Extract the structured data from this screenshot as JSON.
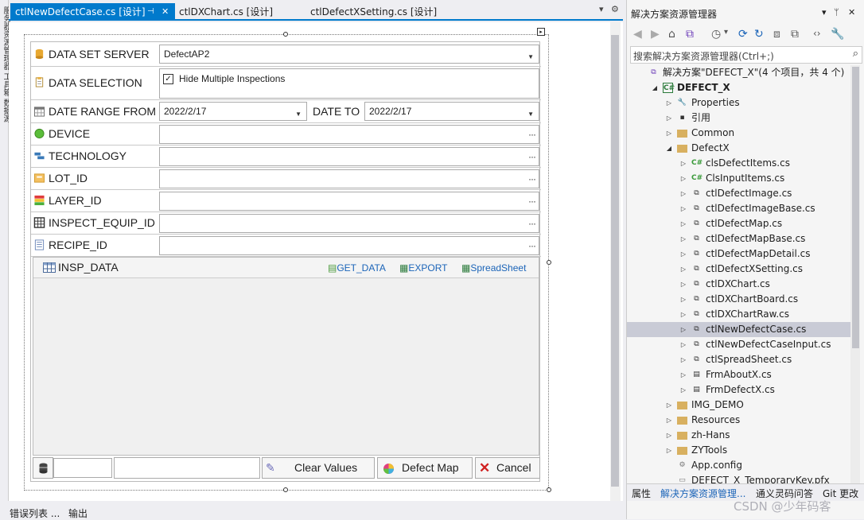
{
  "left_strip": {
    "text": "服务器资源管理器 工具箱 数据源"
  },
  "tabs": [
    {
      "label": "ctlNewDefectCase.cs [设计]",
      "active": true
    },
    {
      "label": "ctlDXChart.cs [设计]",
      "active": false
    },
    {
      "label": "ctlDefectXSetting.cs [设计]",
      "active": false
    }
  ],
  "tab_icons": {
    "pin": "⊣",
    "close": "✕",
    "dropdown": "▾",
    "settings": "⚙"
  },
  "form": {
    "server": {
      "label": "DATA SET SERVER",
      "value": "DefectAP2"
    },
    "selection": {
      "label": "DATA SELECTION",
      "checkbox_label": "Hide Multiple Inspections",
      "checked": true,
      "check_mark": "✓"
    },
    "date_from": {
      "label": "DATE RANGE FROM",
      "value": "2022/2/17"
    },
    "date_to": {
      "label": "DATE TO",
      "value": "2022/2/17"
    },
    "device": {
      "label": "DEVICE",
      "value": ""
    },
    "technology": {
      "label": "TECHNOLOGY",
      "value": ""
    },
    "lot": {
      "label": "LOT_ID",
      "value": ""
    },
    "layer": {
      "label": "LAYER_ID",
      "value": ""
    },
    "equip": {
      "label": "INSPECT_EQUIP_ID",
      "value": ""
    },
    "recipe": {
      "label": "RECIPE_ID",
      "value": ""
    },
    "ellipsis": "···",
    "grid": {
      "title": "INSP_DATA",
      "get_data": "GET_DATA",
      "export": "EXPORT",
      "spreadsheet": "SpreadSheet"
    },
    "buttons": {
      "clear": "Clear Values",
      "map": "Defect Map",
      "cancel": "Cancel"
    }
  },
  "solution_explorer": {
    "title": "解决方案资源管理器",
    "title_icons": {
      "dropdown": "▾",
      "pin": "ᛘ",
      "close": "✕"
    },
    "search_placeholder": "搜索解决方案资源管理器(Ctrl+;)",
    "toolbar": [
      "◀",
      "▶",
      "⌂",
      "⧉",
      "◷",
      "▾",
      "⟳",
      "↻",
      "⧈",
      "⧉",
      "‹›",
      "🔧"
    ],
    "tree": [
      {
        "label": "解决方案\"DEFECT_X\"(4 个项目，共 4 个)",
        "indent": 0,
        "arrow": "",
        "icon": "solution",
        "bold": false
      },
      {
        "label": "DEFECT_X",
        "indent": 1,
        "arrow": "◢",
        "icon": "csproj",
        "bold": true
      },
      {
        "label": "Properties",
        "indent": 2,
        "arrow": "▷",
        "icon": "wrench",
        "bold": false
      },
      {
        "label": "引用",
        "indent": 2,
        "arrow": "▷",
        "icon": "ref",
        "bold": false
      },
      {
        "label": "Common",
        "indent": 2,
        "arrow": "▷",
        "icon": "folder",
        "bold": false
      },
      {
        "label": "DefectX",
        "indent": 2,
        "arrow": "◢",
        "icon": "folder-open",
        "bold": false
      },
      {
        "label": "clsDefectItems.cs",
        "indent": 3,
        "arrow": "▷",
        "icon": "cs",
        "bold": false
      },
      {
        "label": "ClsInputItems.cs",
        "indent": 3,
        "arrow": "▷",
        "icon": "cs",
        "bold": false
      },
      {
        "label": "ctlDefectImage.cs",
        "indent": 3,
        "arrow": "▷",
        "icon": "ctl",
        "bold": false
      },
      {
        "label": "ctlDefectImageBase.cs",
        "indent": 3,
        "arrow": "▷",
        "icon": "ctl",
        "bold": false
      },
      {
        "label": "ctlDefectMap.cs",
        "indent": 3,
        "arrow": "▷",
        "icon": "ctl",
        "bold": false
      },
      {
        "label": "ctlDefectMapBase.cs",
        "indent": 3,
        "arrow": "▷",
        "icon": "ctl",
        "bold": false
      },
      {
        "label": "ctlDefectMapDetail.cs",
        "indent": 3,
        "arrow": "▷",
        "icon": "ctl",
        "bold": false
      },
      {
        "label": "ctlDefectXSetting.cs",
        "indent": 3,
        "arrow": "▷",
        "icon": "ctl",
        "bold": false
      },
      {
        "label": "ctlDXChart.cs",
        "indent": 3,
        "arrow": "▷",
        "icon": "ctl",
        "bold": false
      },
      {
        "label": "ctlDXChartBoard.cs",
        "indent": 3,
        "arrow": "▷",
        "icon": "ctl",
        "bold": false
      },
      {
        "label": "ctlDXChartRaw.cs",
        "indent": 3,
        "arrow": "▷",
        "icon": "ctl",
        "bold": false
      },
      {
        "label": "ctlNewDefectCase.cs",
        "indent": 3,
        "arrow": "▷",
        "icon": "ctl",
        "bold": false,
        "selected": true
      },
      {
        "label": "ctlNewDefectCaseInput.cs",
        "indent": 3,
        "arrow": "▷",
        "icon": "ctl",
        "bold": false
      },
      {
        "label": "ctlSpreadSheet.cs",
        "indent": 3,
        "arrow": "▷",
        "icon": "ctl",
        "bold": false
      },
      {
        "label": "FrmAboutX.cs",
        "indent": 3,
        "arrow": "▷",
        "icon": "frm",
        "bold": false
      },
      {
        "label": "FrmDefectX.cs",
        "indent": 3,
        "arrow": "▷",
        "icon": "frm",
        "bold": false
      },
      {
        "label": "IMG_DEMO",
        "indent": 2,
        "arrow": "▷",
        "icon": "folder",
        "bold": false
      },
      {
        "label": "Resources",
        "indent": 2,
        "arrow": "▷",
        "icon": "folder",
        "bold": false
      },
      {
        "label": "zh-Hans",
        "indent": 2,
        "arrow": "▷",
        "icon": "folder",
        "bold": false
      },
      {
        "label": "ZYTools",
        "indent": 2,
        "arrow": "▷",
        "icon": "folder",
        "bold": false
      },
      {
        "label": "App.config",
        "indent": 2,
        "arrow": "",
        "icon": "config",
        "bold": false
      },
      {
        "label": "DEFECT_X_TemporaryKey.pfx",
        "indent": 2,
        "arrow": "",
        "icon": "pfx",
        "bold": false
      }
    ],
    "bottom_tabs": [
      "属性",
      "解决方案资源管理...",
      "通义灵码问答",
      "Git 更改"
    ]
  },
  "status_tabs": [
    "错误列表 ...",
    "输出"
  ],
  "watermark": "CSDN @少年码客",
  "colors": {
    "accent": "#007acc",
    "link": "#1b64b8",
    "selection": "#c9cbd6"
  }
}
